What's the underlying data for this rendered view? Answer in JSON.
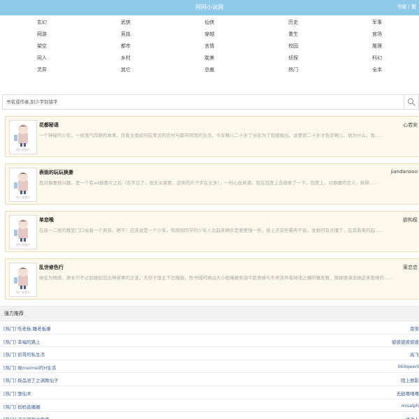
{
  "header": {
    "site_title": "阿阿小说网",
    "link_bookshelf": "书架",
    "separator": "|",
    "link_more": "繁"
  },
  "categories": [
    "玄幻",
    "武侠",
    "仙侠",
    "历史",
    "军事",
    "网游",
    "竞技",
    "穿越",
    "重生",
    "官场",
    "架空",
    "都市",
    "言情",
    "校园",
    "推理",
    "同人",
    "乡村",
    "耽美",
    "侦探",
    "科幻",
    "灵异",
    "其它",
    "总裁",
    "热门",
    "全本"
  ],
  "search": {
    "placeholder": "书名或作者,别少字别错字",
    "icon": "search-icon"
  },
  "books": [
    {
      "title": "花都秘语",
      "author": "心若安",
      "desc": "一个神秘的少年，一段落气四赖的故事，且看主角如何在青涩的农村与都市闯荡的生活，今年略儿二十岁了当年为了陪嫂嫂出，说要到二十岁才告诉略儿，他为什么，我……",
      "cover_caption": "图片准备中"
    },
    {
      "title": "表姐的玩玩换妻",
      "author": "jiandanooo",
      "desc": "我对换妻很兴趣，是一个有ad换妻片之后（名字忘了，但无关紧要，这类的片子实在太多），一时心血来潮，就在百度上去搜索了一下，百度上，对换妻的定义，解释……",
      "cover_caption": "图片准备中"
    },
    {
      "title": "单恋喉",
      "author": "欲构极",
      "desc": "在高一二班的教室门口站着一个男孩，嗯不！应该说是一个少年，和周围同学的少年人比起来确实是要更强一些，身上去有些霸秀不俗，发耐的有点懂了，在其看来的起……",
      "cover_caption": "图片准备中"
    },
    {
      "title": "乱世修色行",
      "author": "莱恋恋",
      "desc": "她名为晴嫣，原本只不过到她如剑出神将軍的正道，无奈于国主下旨赐婚，而书城的嫡出大小姐嘴硬柔弱不愿意嫁与外男该件看邮递之嫌的嘱各敬，随嫁便满追她这来惹她的……",
      "cover_caption": "图片准备中"
    }
  ],
  "recommend": {
    "title": "强力推荐",
    "items": [
      {
        "title": "[热门] 吃老板,睡老板嫌",
        "author": "亩渐"
      },
      {
        "title": "[热门] 幸福的路上",
        "author": "彼彼彼彼彼彼"
      },
      {
        "title": "[热门] 凯哥的私生活",
        "author": "高飞"
      },
      {
        "title": "[热门] 母meimei的H生活",
        "author": "360qwert"
      },
      {
        "title": "[热门] 极品浪丁之调教仙子",
        "author": "陌上丽影"
      },
      {
        "title": "[热门] 堕仙术",
        "author": "无敌嘻嘻嘻"
      },
      {
        "title": "[热门] 妈妈直播圈",
        "author": "misalph"
      },
      {
        "title": "[热门] 逆天邪神之完美",
        "author": "透遥人"
      },
      {
        "title": "[热门] 遇到（H）",
        "author": "尼古拉斯"
      }
    ]
  }
}
